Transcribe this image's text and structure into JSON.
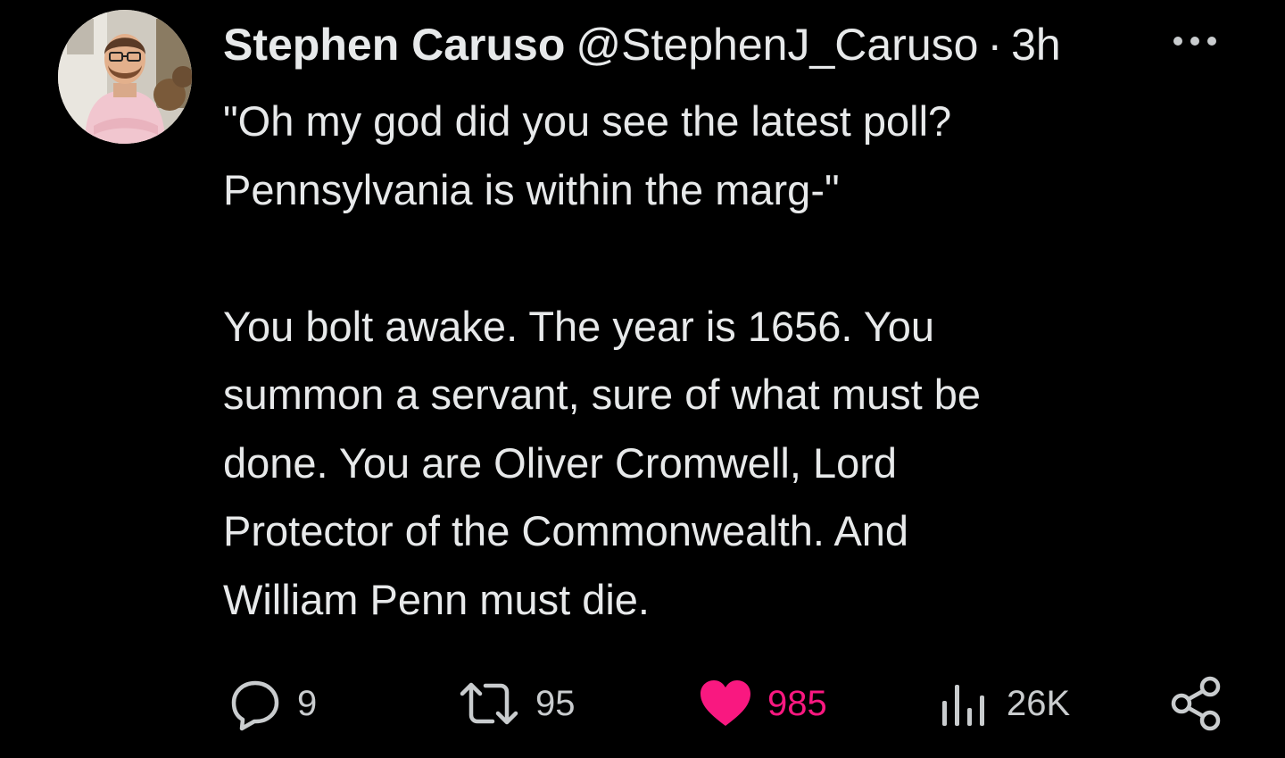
{
  "tweet": {
    "author": {
      "display_name": "Stephen Caruso",
      "handle": "@StephenJ_Caruso",
      "avatar_icon": "profile-photo"
    },
    "separator": "·",
    "timestamp": "3h",
    "more_icon": "more-dots-icon",
    "text": "\"Oh my god did you see the latest poll?\nPennsylvania is within the marg-\"\n\nYou bolt awake. The year is 1656. You\nsummon a servant, sure of what must be\ndone. You are Oliver Cromwell, Lord\nProtector of the Commonwealth. And\nWilliam Penn must die.",
    "actions": {
      "replies": "9",
      "retweets": "95",
      "likes": "985",
      "views": "26K"
    },
    "colors": {
      "background": "#000000",
      "text": "#e7e9ea",
      "like_accent": "#f91880"
    }
  }
}
